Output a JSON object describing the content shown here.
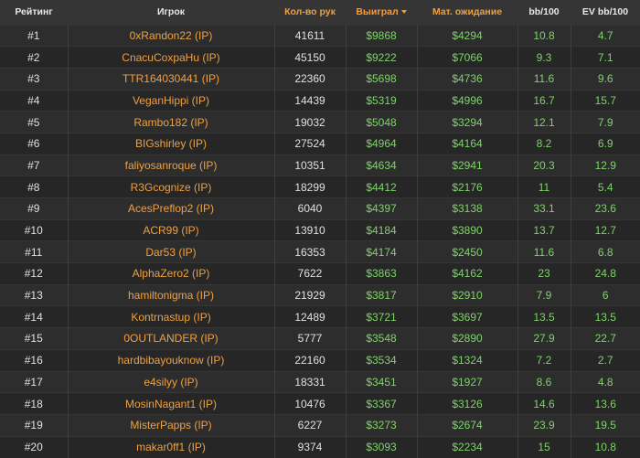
{
  "headers": {
    "rank": "Рейтинг",
    "player": "Игрок",
    "hands": "Кол-во рук",
    "won": "Выиграл",
    "ev": "Мат. ожидание",
    "bb100": "bb/100",
    "evbb100": "EV bb/100"
  },
  "rows": [
    {
      "rank": "#1",
      "player": "0xRandon22 (IP)",
      "hands": "41611",
      "won": "$9868",
      "ev": "$4294",
      "bb100": "10.8",
      "evbb100": "4.7"
    },
    {
      "rank": "#2",
      "player": "CnacuCoxpaHu (IP)",
      "hands": "45150",
      "won": "$9222",
      "ev": "$7066",
      "bb100": "9.3",
      "evbb100": "7.1"
    },
    {
      "rank": "#3",
      "player": "TTR164030441 (IP)",
      "hands": "22360",
      "won": "$5698",
      "ev": "$4736",
      "bb100": "11.6",
      "evbb100": "9.6"
    },
    {
      "rank": "#4",
      "player": "VeganHippi (IP)",
      "hands": "14439",
      "won": "$5319",
      "ev": "$4996",
      "bb100": "16.7",
      "evbb100": "15.7"
    },
    {
      "rank": "#5",
      "player": "Rambo182 (IP)",
      "hands": "19032",
      "won": "$5048",
      "ev": "$3294",
      "bb100": "12.1",
      "evbb100": "7.9"
    },
    {
      "rank": "#6",
      "player": "BIGshirley (IP)",
      "hands": "27524",
      "won": "$4964",
      "ev": "$4164",
      "bb100": "8.2",
      "evbb100": "6.9"
    },
    {
      "rank": "#7",
      "player": "faliyosanroque (IP)",
      "hands": "10351",
      "won": "$4634",
      "ev": "$2941",
      "bb100": "20.3",
      "evbb100": "12.9"
    },
    {
      "rank": "#8",
      "player": "R3Gcognize (IP)",
      "hands": "18299",
      "won": "$4412",
      "ev": "$2176",
      "bb100": "11",
      "evbb100": "5.4"
    },
    {
      "rank": "#9",
      "player": "AcesPreflop2 (IP)",
      "hands": "6040",
      "won": "$4397",
      "ev": "$3138",
      "bb100": "33.1",
      "evbb100": "23.6"
    },
    {
      "rank": "#10",
      "player": "ACR99 (IP)",
      "hands": "13910",
      "won": "$4184",
      "ev": "$3890",
      "bb100": "13.7",
      "evbb100": "12.7"
    },
    {
      "rank": "#11",
      "player": "Dar53 (IP)",
      "hands": "16353",
      "won": "$4174",
      "ev": "$2450",
      "bb100": "11.6",
      "evbb100": "6.8"
    },
    {
      "rank": "#12",
      "player": "AlphaZero2 (IP)",
      "hands": "7622",
      "won": "$3863",
      "ev": "$4162",
      "bb100": "23",
      "evbb100": "24.8"
    },
    {
      "rank": "#13",
      "player": "hamiltonigma (IP)",
      "hands": "21929",
      "won": "$3817",
      "ev": "$2910",
      "bb100": "7.9",
      "evbb100": "6"
    },
    {
      "rank": "#14",
      "player": "Kontrnastup (IP)",
      "hands": "12489",
      "won": "$3721",
      "ev": "$3697",
      "bb100": "13.5",
      "evbb100": "13.5"
    },
    {
      "rank": "#15",
      "player": "0OUTLANDER (IP)",
      "hands": "5777",
      "won": "$3548",
      "ev": "$2890",
      "bb100": "27.9",
      "evbb100": "22.7"
    },
    {
      "rank": "#16",
      "player": "hardbibayouknow (IP)",
      "hands": "22160",
      "won": "$3534",
      "ev": "$1324",
      "bb100": "7.2",
      "evbb100": "2.7"
    },
    {
      "rank": "#17",
      "player": "e4silyy (IP)",
      "hands": "18331",
      "won": "$3451",
      "ev": "$1927",
      "bb100": "8.6",
      "evbb100": "4.8"
    },
    {
      "rank": "#18",
      "player": "MosinNagant1 (IP)",
      "hands": "10476",
      "won": "$3367",
      "ev": "$3126",
      "bb100": "14.6",
      "evbb100": "13.6"
    },
    {
      "rank": "#19",
      "player": "MisterPapps (IP)",
      "hands": "6227",
      "won": "$3273",
      "ev": "$2674",
      "bb100": "23.9",
      "evbb100": "19.5"
    },
    {
      "rank": "#20",
      "player": "makar0ff1 (IP)",
      "hands": "9374",
      "won": "$3093",
      "ev": "$2234",
      "bb100": "15",
      "evbb100": "10.8"
    }
  ]
}
